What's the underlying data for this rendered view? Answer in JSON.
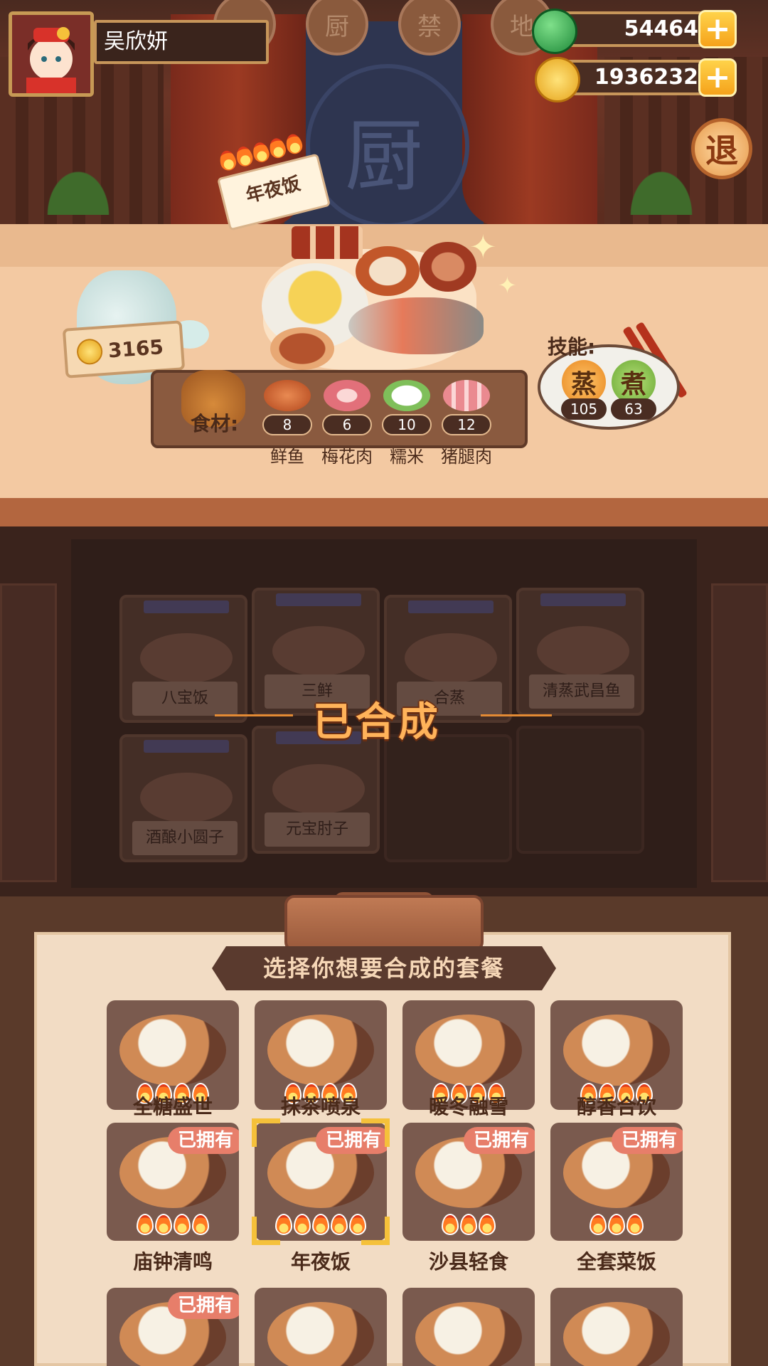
{
  "player": {
    "name": "吴欣妍"
  },
  "currency": {
    "jade": "54464",
    "gold": "1936232",
    "plus": "+"
  },
  "exit_label": "退",
  "stage": {
    "sign": "厨",
    "medallions": [
      "",
      "厨",
      "禁",
      "地"
    ]
  },
  "current_dish": {
    "name": "年夜饭",
    "coin_value": "3165",
    "ingredients_label": "食材:",
    "ingredients": [
      {
        "name": "鲜鱼",
        "count": "8"
      },
      {
        "name": "梅花肉",
        "count": "6"
      },
      {
        "name": "糯米",
        "count": "10"
      },
      {
        "name": "猪腿肉",
        "count": "12"
      }
    ],
    "skills_label": "技能:",
    "skills": [
      {
        "name": "蒸",
        "value": "105",
        "color": "#f3a53a"
      },
      {
        "name": "煮",
        "value": "63",
        "color": "#8ec64a"
      }
    ]
  },
  "made_dishes": [
    "八宝饭",
    "三鲜",
    "合蒸",
    "清蒸武昌鱼",
    "酒酿小圆子",
    "元宝肘子"
  ],
  "synthesized_label": "已合成",
  "panel_title": "选择你想要合成的套餐",
  "owned_label": "已拥有",
  "meals_row1": [
    "全糖盛世",
    "抹茶喷泉",
    "暖冬融雪",
    "醇香合饮"
  ],
  "meals_row2": [
    "庙钟清鸣",
    "年夜饭",
    "沙县轻食",
    "全套菜饭"
  ],
  "colors": {
    "accent": "#f5c13a",
    "owned_badge": "#e77e6a",
    "synth_text": "#ffb35a"
  }
}
